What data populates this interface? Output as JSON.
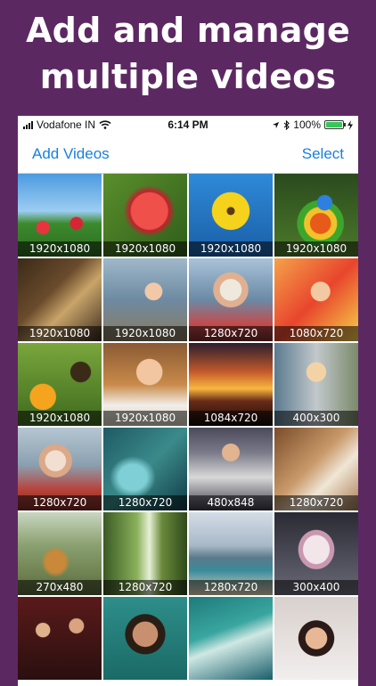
{
  "headline": {
    "line1": "Add and manage",
    "line2": "multiple videos"
  },
  "status_bar": {
    "carrier": "Vodafone IN",
    "time": "6:14 PM",
    "battery_text": "100%",
    "battery_level": 1.0,
    "icons": [
      "signal-icon",
      "wifi-icon",
      "location-icon",
      "bluetooth-icon",
      "battery-icon",
      "charging-icon"
    ]
  },
  "nav": {
    "add_label": "Add Videos",
    "select_label": "Select",
    "accent_color": "#1a7fe0"
  },
  "videos": [
    {
      "res": "1920x1080",
      "subject": "red flowers under blue sky"
    },
    {
      "res": "1920x1080",
      "subject": "red rose"
    },
    {
      "res": "1920x1080",
      "subject": "yellow flower on blue"
    },
    {
      "res": "1920x1080",
      "subject": "parrot"
    },
    {
      "res": "1920x1080",
      "subject": "hands with cup"
    },
    {
      "res": "1920x1080",
      "subject": "girl with cat"
    },
    {
      "res": "1280x720",
      "subject": "woman with white hat by lake"
    },
    {
      "res": "1080x720",
      "subject": "woman with colored powder"
    },
    {
      "res": "1920x1080",
      "subject": "butterfly on flowers"
    },
    {
      "res": "1920x1080",
      "subject": "girl reading with glasses"
    },
    {
      "res": "1084x720",
      "subject": "silhouettes at sunset"
    },
    {
      "res": "400x300",
      "subject": "woman in store"
    },
    {
      "res": "1280x720",
      "subject": "woman in white hat"
    },
    {
      "res": "1280x720",
      "subject": "aerial sea"
    },
    {
      "res": "480x848",
      "subject": "woman in shop"
    },
    {
      "res": "1280x720",
      "subject": "writing hand"
    },
    {
      "res": "270x480",
      "subject": "tiger in tree"
    },
    {
      "res": "1280x720",
      "subject": "forest path"
    },
    {
      "res": "1280x720",
      "subject": "city beach"
    },
    {
      "res": "300x400",
      "subject": "woman with umbrella"
    },
    {
      "res": "",
      "subject": "crowd of people"
    },
    {
      "res": "",
      "subject": "smiling man with glasses"
    },
    {
      "res": "",
      "subject": "ocean wave"
    },
    {
      "res": "",
      "subject": "woman portrait"
    }
  ]
}
